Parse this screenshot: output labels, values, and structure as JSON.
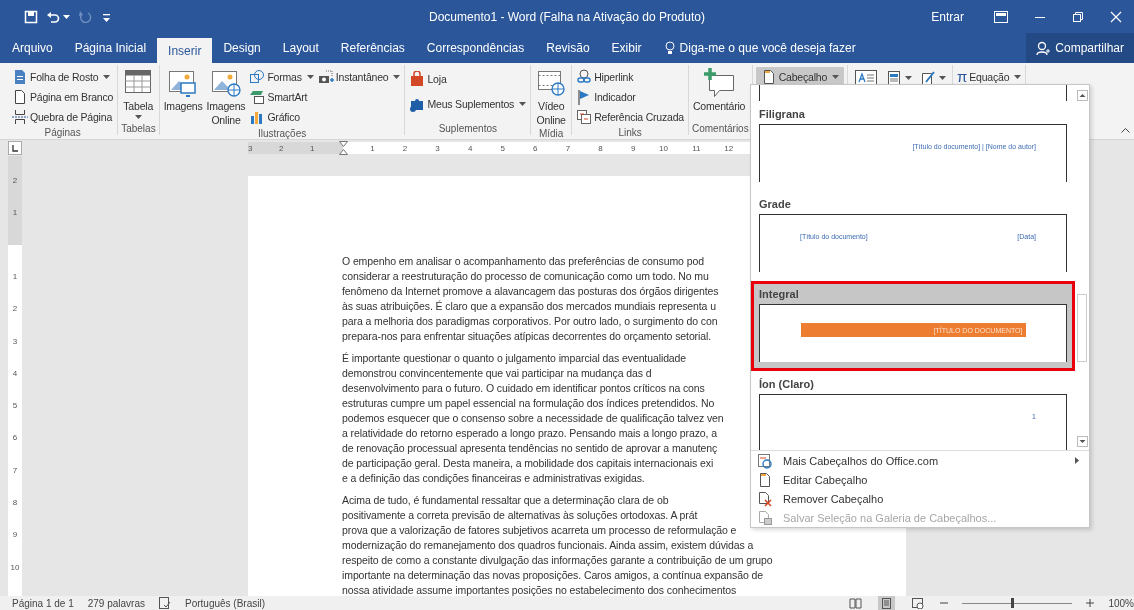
{
  "title_bar": {
    "title": "Documento1 - Word (Falha na Ativação do Produto)",
    "sign_in": "Entrar",
    "quick_access": [
      {
        "kind": "save",
        "disabled": false
      },
      {
        "kind": "undo",
        "disabled": false
      },
      {
        "kind": "redo",
        "disabled": true
      },
      {
        "kind": "customize",
        "disabled": false
      }
    ]
  },
  "tabs": [
    {
      "label": "Arquivo",
      "selected": false
    },
    {
      "label": "Página Inicial",
      "selected": false
    },
    {
      "label": "Inserir",
      "selected": true
    },
    {
      "label": "Design",
      "selected": false
    },
    {
      "label": "Layout",
      "selected": false
    },
    {
      "label": "Referências",
      "selected": false
    },
    {
      "label": "Correspondências",
      "selected": false
    },
    {
      "label": "Revisão",
      "selected": false
    },
    {
      "label": "Exibir",
      "selected": false
    }
  ],
  "tell_me": {
    "placeholder": "Diga-me o que você deseja fazer"
  },
  "share": "Compartilhar",
  "ribbon": {
    "groups": [
      {
        "label": "Páginas",
        "columns": [
          [
            {
              "kind": "small",
              "label": "Folha de Rosto",
              "dropdown": true
            },
            {
              "kind": "small",
              "label": "Página em Branco"
            },
            {
              "kind": "small",
              "label": "Quebra de Página"
            }
          ]
        ]
      },
      {
        "label": "Tabelas",
        "columns": [
          [
            {
              "kind": "large",
              "label": "Tabela",
              "dropdown": true
            }
          ]
        ]
      },
      {
        "label": "Ilustrações",
        "columns": [
          [
            {
              "kind": "large",
              "label": "Imagens"
            }
          ],
          [
            {
              "kind": "large",
              "label": "Imagens Online"
            }
          ],
          [
            {
              "kind": "small",
              "label": "Formas",
              "dropdown": true
            },
            {
              "kind": "small",
              "label": "SmartArt"
            },
            {
              "kind": "small",
              "label": "Gráfico"
            }
          ],
          [
            {
              "kind": "small",
              "label": "Instantâneo",
              "dropdown": true
            }
          ]
        ]
      },
      {
        "label": "Suplementos",
        "columns": [
          [
            {
              "kind": "small",
              "label": "Loja"
            },
            {
              "kind": "small",
              "label": "Meus Suplementos",
              "dropdown": true
            }
          ]
        ]
      },
      {
        "label": "Mídia",
        "columns": [
          [
            {
              "kind": "large",
              "label": "Vídeo Online"
            }
          ]
        ]
      },
      {
        "label": "Links",
        "columns": [
          [
            {
              "kind": "small",
              "label": "Hiperlink"
            },
            {
              "kind": "small",
              "label": "Indicador"
            },
            {
              "kind": "small",
              "label": "Referência Cruzada"
            }
          ]
        ]
      },
      {
        "label": "Comentários",
        "columns": [
          [
            {
              "kind": "large",
              "label": "Comentário"
            }
          ]
        ]
      },
      {
        "columns": [
          [
            {
              "kind": "small",
              "label": "Cabeçalho",
              "dropdown": true,
              "expanded": true
            }
          ]
        ]
      },
      {
        "columns": [
          [
            {
              "kind": "icon"
            }
          ],
          [
            {
              "kind": "icon",
              "dropdown": true
            }
          ],
          [
            {
              "kind": "icon",
              "dropdown": true
            }
          ]
        ]
      },
      {
        "columns": [
          [
            {
              "kind": "symbol",
              "symbol": "π",
              "label": "Equação",
              "dropdown": true
            }
          ]
        ]
      }
    ]
  },
  "ruler": {
    "left_labels": [
      "3",
      "2",
      "1"
    ],
    "right_labels": [
      "1",
      "2",
      "3",
      "4",
      "5",
      "6",
      "7",
      "8",
      "9",
      "10",
      "11",
      "12"
    ]
  },
  "vertical_ruler": {
    "top_labels": [
      "2",
      "1"
    ],
    "body_labels": [
      "1",
      "2",
      "3",
      "4",
      "5",
      "6",
      "7",
      "8",
      "9",
      "10"
    ]
  },
  "document": {
    "paragraphs": [
      [
        "O empenho em analisar o acompanhamento das preferências de consumo pod",
        "considerar a reestruturação do processo de comunicação como um todo. No mu",
        "fenômeno da Internet promove a alavancagem das posturas dos órgãos dirigentes",
        "às suas atribuições. É claro que a expansão dos mercados mundiais representa u",
        "para a melhoria dos paradigmas corporativos. Por outro lado, o surgimento do con",
        "prepara-nos para enfrentar situações atípicas decorrentes do orçamento setorial."
      ],
      [
        "É importante questionar o quanto o julgamento imparcial das eventualidade",
        "demonstrou convincentemente que vai participar na mudança das d",
        "desenvolvimento para o futuro. O cuidado em identificar pontos críticos na cons",
        "estruturas cumpre um papel essencial na formulação dos índices pretendidos. No",
        "podemos esquecer que o consenso sobre a necessidade de qualificação talvez ven",
        "a relatividade do retorno esperado a longo prazo. Pensando mais a longo prazo, a",
        "de renovação processual apresenta tendências no sentido de aprovar a manutenç",
        "de participação geral. Desta maneira, a mobilidade dos capitais internacionais exi",
        "e a definição das condições financeiras e administrativas exigidas."
      ],
      [
        "Acima de tudo, é fundamental ressaltar que a determinação clara de ob",
        "positivamente a correta previsão de alternativas às soluções ortodoxas. A prát",
        "prova que a valorização de fatores subjetivos acarreta um processo de reformulação e",
        "modernização do remanejamento dos quadros funcionais. Ainda assim, existem dúvidas a",
        "respeito de como a constante divulgação das informações garante a contribuição de um grupo",
        "importante na determinação das novas proposições. Caros amigos, a contínua expansão de",
        "nossa atividade assume importantes posições no estabelecimento dos conhecimentos"
      ]
    ]
  },
  "header_menu": {
    "gallery": [
      {
        "name": "Filigrana",
        "selected": false,
        "preview": {
          "kind": "right",
          "texts": [
            "[Título do documento] | [Nome do autor]"
          ]
        }
      },
      {
        "name": "Grade",
        "selected": false,
        "preview": {
          "kind": "split",
          "texts": [
            "[Título do documento]",
            "[Data]"
          ]
        }
      },
      {
        "name": "Integral",
        "selected": true,
        "preview": {
          "kind": "band",
          "texts": [
            "[TÍTULO DO DOCUMENTO]"
          ]
        }
      },
      {
        "name": "Íon (Claro)",
        "selected": false,
        "preview": {
          "kind": "right",
          "texts": [
            "1"
          ]
        }
      }
    ],
    "commands": [
      {
        "label": "Mais Cabeçalhos do Office.com",
        "submenu": true,
        "disabled": false
      },
      {
        "label": "Editar Cabeçalho",
        "submenu": false,
        "disabled": false
      },
      {
        "label": "Remover Cabeçalho",
        "submenu": false,
        "disabled": false
      },
      {
        "label": "Salvar Seleção na Galeria de Cabeçalhos...",
        "submenu": false,
        "disabled": true
      }
    ]
  },
  "status_bar": {
    "page": "Página 1 de 1",
    "words": "279 palavras",
    "language": "Português (Brasil)",
    "views": [
      {
        "selected": false
      },
      {
        "selected": true
      },
      {
        "selected": false
      }
    ],
    "zoom": {
      "label": "100%",
      "level": 0.45
    }
  }
}
